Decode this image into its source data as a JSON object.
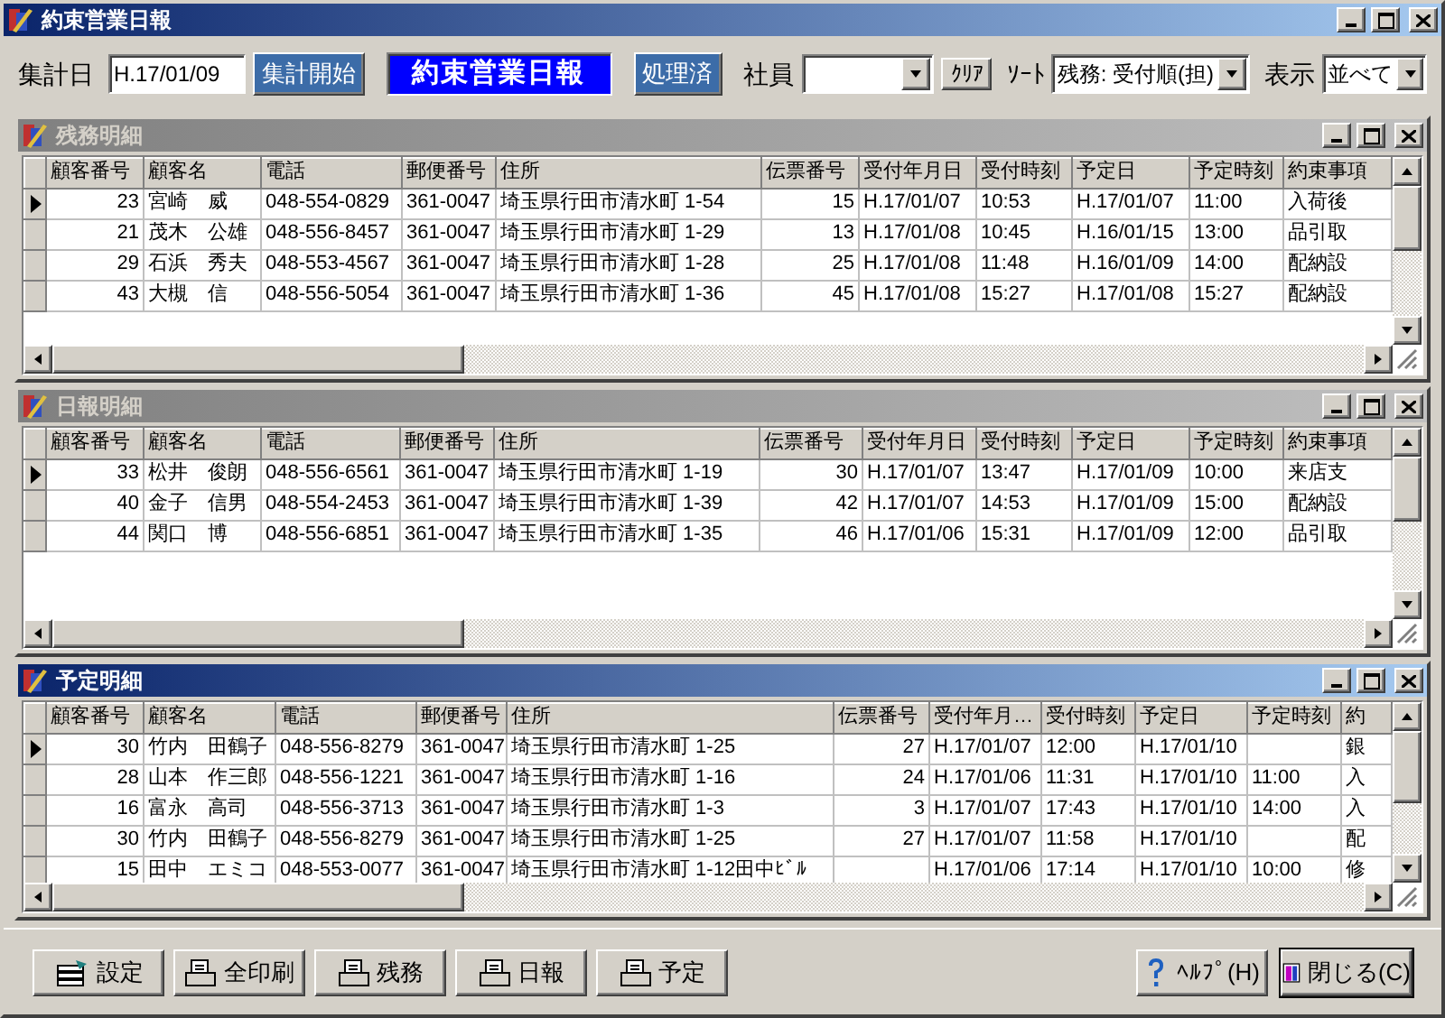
{
  "window": {
    "title": "約束営業日報",
    "active": true
  },
  "toolbar": {
    "date_label": "集計日",
    "date_value": "H.17/01/09",
    "start_button": "集計開始",
    "banner": "約束営業日報",
    "done_button": "処理済",
    "staff_label": "社員",
    "clear_button": "ｸﾘｱ",
    "sort_label": "ｿｰﾄ",
    "sort_value": "残務: 受付順(担)",
    "view_label": "表示",
    "view_value": "並べて"
  },
  "panels": [
    {
      "title": "残務明細",
      "active": false,
      "columns": [
        "顧客番号",
        "顧客名",
        "電話",
        "郵便番号",
        "住所",
        "伝票番号",
        "受付年月日",
        "受付時刻",
        "予定日",
        "予定時刻",
        "約束事項"
      ],
      "rows": [
        {
          "selected": true,
          "cells": [
            "23",
            "宮崎　威",
            "048-554-0829",
            "361-0047",
            "埼玉県行田市清水町 1-54",
            "15",
            "H.17/01/07",
            "10:53",
            "H.17/01/07",
            "11:00",
            "入荷後"
          ]
        },
        {
          "selected": false,
          "cells": [
            "21",
            "茂木　公雄",
            "048-556-8457",
            "361-0047",
            "埼玉県行田市清水町 1-29",
            "13",
            "H.17/01/08",
            "10:45",
            "H.16/01/15",
            "13:00",
            "品引取"
          ]
        },
        {
          "selected": false,
          "cells": [
            "29",
            "石浜　秀夫",
            "048-553-4567",
            "361-0047",
            "埼玉県行田市清水町 1-28",
            "25",
            "H.17/01/08",
            "11:48",
            "H.16/01/09",
            "14:00",
            "配納設"
          ]
        },
        {
          "selected": false,
          "cells": [
            "43",
            "大槻　信",
            "048-556-5054",
            "361-0047",
            "埼玉県行田市清水町 1-36",
            "45",
            "H.17/01/08",
            "15:27",
            "H.17/01/08",
            "15:27",
            "配納設"
          ]
        }
      ]
    },
    {
      "title": "日報明細",
      "active": false,
      "columns": [
        "顧客番号",
        "顧客名",
        "電話",
        "郵便番号",
        "住所",
        "伝票番号",
        "受付年月日",
        "受付時刻",
        "予定日",
        "予定時刻",
        "約束事項"
      ],
      "rows": [
        {
          "selected": true,
          "cells": [
            "33",
            "松井　俊朗",
            "048-556-6561",
            "361-0047",
            "埼玉県行田市清水町 1-19",
            "30",
            "H.17/01/07",
            "13:47",
            "H.17/01/09",
            "10:00",
            "来店支"
          ]
        },
        {
          "selected": false,
          "cells": [
            "40",
            "金子　信男",
            "048-554-2453",
            "361-0047",
            "埼玉県行田市清水町 1-39",
            "42",
            "H.17/01/07",
            "14:53",
            "H.17/01/09",
            "15:00",
            "配納設"
          ]
        },
        {
          "selected": false,
          "cells": [
            "44",
            "関口　博",
            "048-556-6851",
            "361-0047",
            "埼玉県行田市清水町 1-35",
            "46",
            "H.17/01/06",
            "15:31",
            "H.17/01/09",
            "12:00",
            "品引取"
          ]
        }
      ]
    },
    {
      "title": "予定明細",
      "active": true,
      "columns": [
        "顧客番号",
        "顧客名",
        "電話",
        "郵便番号",
        "住所",
        "伝票番号",
        "受付年月…",
        "受付時刻",
        "予定日",
        "予定時刻",
        "約"
      ],
      "rows": [
        {
          "selected": true,
          "cells": [
            "30",
            "竹内　田鶴子",
            "048-556-8279",
            "361-0047",
            "埼玉県行田市清水町 1-25",
            "27",
            "H.17/01/07",
            "12:00",
            "H.17/01/10",
            "",
            "銀"
          ]
        },
        {
          "selected": false,
          "cells": [
            "28",
            "山本　作三郎",
            "048-556-1221",
            "361-0047",
            "埼玉県行田市清水町 1-16",
            "24",
            "H.17/01/06",
            "11:31",
            "H.17/01/10",
            "11:00",
            "入"
          ]
        },
        {
          "selected": false,
          "cells": [
            "16",
            "富永　高司",
            "048-556-3713",
            "361-0047",
            "埼玉県行田市清水町 1-3",
            "3",
            "H.17/01/07",
            "17:43",
            "H.17/01/10",
            "14:00",
            "入"
          ]
        },
        {
          "selected": false,
          "cells": [
            "30",
            "竹内　田鶴子",
            "048-556-8279",
            "361-0047",
            "埼玉県行田市清水町 1-25",
            "27",
            "H.17/01/07",
            "11:58",
            "H.17/01/10",
            "",
            "配"
          ]
        },
        {
          "selected": false,
          "cells": [
            "15",
            "田中　エミコ",
            "048-553-0077",
            "361-0047",
            "埼玉県行田市清水町 1-12田中ﾋﾞﾙ",
            "",
            "H.17/01/06",
            "17:14",
            "H.17/01/10",
            "10:00",
            "修"
          ]
        }
      ]
    }
  ],
  "buttons": [
    {
      "label": "設定",
      "kind": "settings",
      "default": false
    },
    {
      "label": "全印刷",
      "kind": "print",
      "default": false
    },
    {
      "label": "残務",
      "kind": "print",
      "default": false
    },
    {
      "label": "日報",
      "kind": "print",
      "default": false
    },
    {
      "label": "予定",
      "kind": "print",
      "default": false
    },
    {
      "label": "ﾍﾙﾌﾟ(H)",
      "kind": "help",
      "default": false
    },
    {
      "label": "閉じる(C)",
      "kind": "close",
      "default": true
    }
  ]
}
